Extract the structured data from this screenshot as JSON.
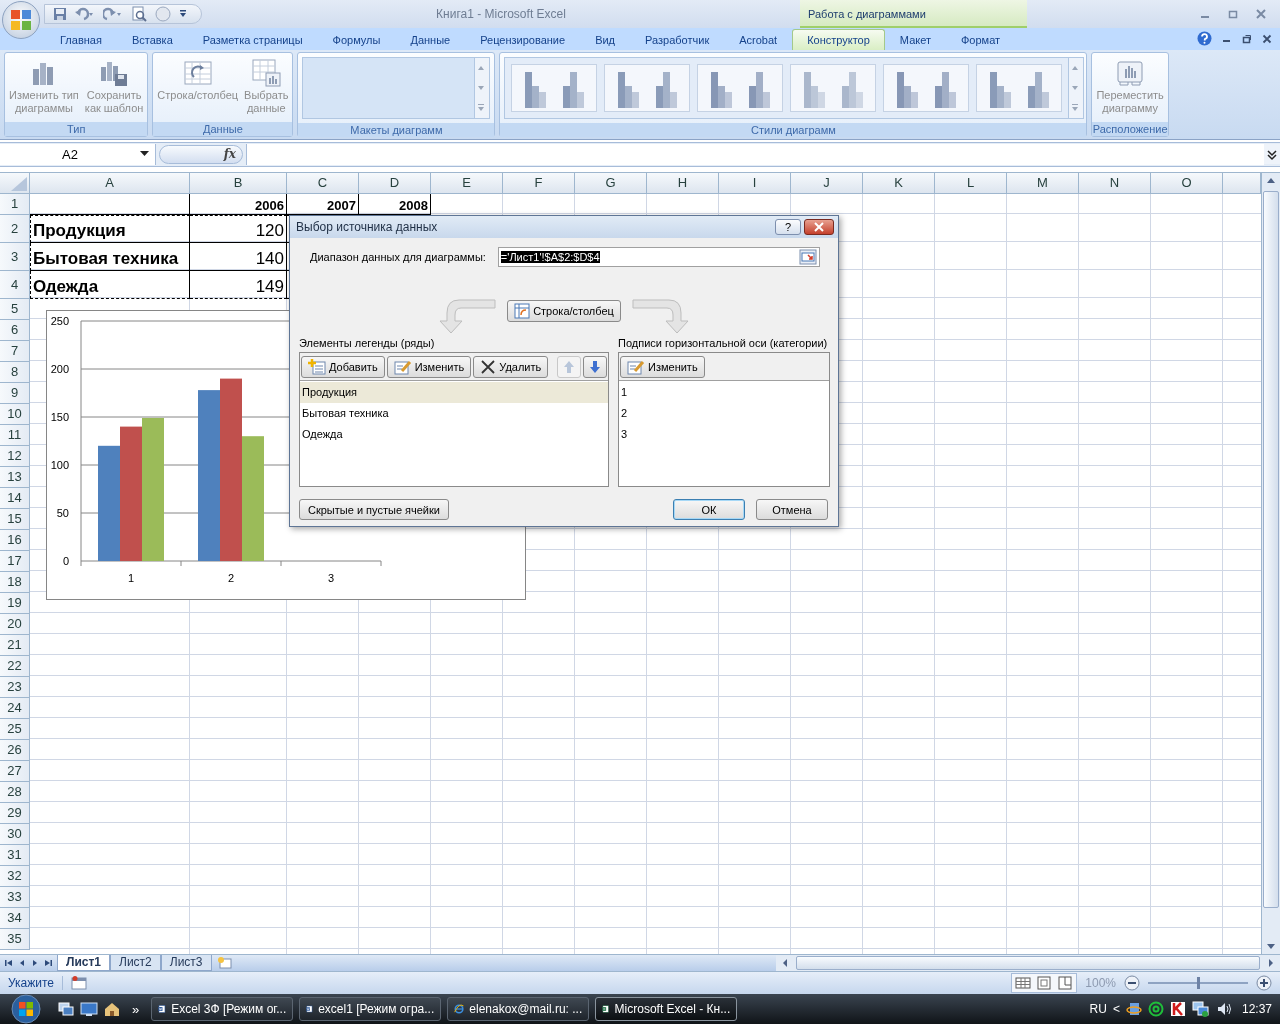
{
  "window": {
    "title": "Книга1  -  Microsoft Excel",
    "context_tab": "Работа с диаграммами"
  },
  "ribbon_tabs": [
    {
      "label": "Главная",
      "selected": false
    },
    {
      "label": "Вставка",
      "selected": false
    },
    {
      "label": "Разметка страницы",
      "selected": false
    },
    {
      "label": "Формулы",
      "selected": false
    },
    {
      "label": "Данные",
      "selected": false
    },
    {
      "label": "Рецензирование",
      "selected": false
    },
    {
      "label": "Вид",
      "selected": false
    },
    {
      "label": "Разработчик",
      "selected": false
    },
    {
      "label": "Acrobat",
      "selected": false
    },
    {
      "label": "Конструктор",
      "selected": true
    },
    {
      "label": "Макет",
      "selected": false
    },
    {
      "label": "Формат",
      "selected": false
    }
  ],
  "ribbon_groups": [
    {
      "kind": "buttons",
      "title": "Тип",
      "buttons": [
        {
          "kind": "chart",
          "lines": [
            "Изменить тип",
            "диаграммы"
          ],
          "disabled": true
        },
        {
          "kind": "template",
          "lines": [
            "Сохранить",
            "как шаблон"
          ],
          "disabled": true
        }
      ]
    },
    {
      "kind": "buttons",
      "title": "Данные",
      "buttons": [
        {
          "kind": "switch",
          "lines": [
            "Строка/столбец"
          ],
          "disabled": true
        },
        {
          "kind": "select",
          "lines": [
            "Выбрать",
            "данные"
          ],
          "disabled": true
        }
      ]
    },
    {
      "kind": "gallery",
      "title": "Макеты диаграмм"
    },
    {
      "kind": "styles",
      "title": "Стили диаграмм",
      "thumbnails": [
        {
          "color": "#8a9bb8"
        },
        {
          "color": "#8a9bb8"
        },
        {
          "color": "#8797b5"
        },
        {
          "color": "#aab7cc"
        },
        {
          "color": "#8797b5"
        },
        {
          "color": "#8a9bb8"
        }
      ]
    },
    {
      "kind": "buttons",
      "title": "Расположение",
      "buttons": [
        {
          "kind": "move",
          "lines": [
            "Переместить",
            "диаграмму"
          ],
          "disabled": true
        }
      ]
    }
  ],
  "formula_bar": {
    "name_box": "A2",
    "function_label": "fx"
  },
  "sheet": {
    "columns": [
      {
        "label": "A",
        "marked": true
      },
      {
        "label": "B",
        "marked": true
      },
      {
        "label": "C",
        "marked": true
      },
      {
        "label": "D",
        "marked": true
      },
      {
        "label": "E",
        "marked": false
      },
      {
        "label": "F",
        "marked": false
      },
      {
        "label": "G",
        "marked": false
      },
      {
        "label": "H",
        "marked": false
      },
      {
        "label": "I",
        "marked": false
      },
      {
        "label": "J",
        "marked": false
      },
      {
        "label": "K",
        "marked": false
      },
      {
        "label": "L",
        "marked": false
      },
      {
        "label": "M",
        "marked": false
      },
      {
        "label": "N",
        "marked": false
      },
      {
        "label": "O",
        "marked": false
      }
    ],
    "rows": [
      {
        "number": "1",
        "kind": "header",
        "marked": false,
        "cells": {
          "B": "2006",
          "C": "2007",
          "D": "2008"
        }
      },
      {
        "number": "2",
        "kind": "big",
        "marked": true,
        "cells": {
          "A": "Продукция",
          "B": "120"
        }
      },
      {
        "number": "3",
        "kind": "big",
        "marked": true,
        "cells": {
          "A": "Бытовая техника",
          "B": "140"
        }
      },
      {
        "number": "4",
        "kind": "big",
        "marked": true,
        "cells": {
          "A": "Одежда",
          "B": "149"
        }
      },
      {
        "number": "5",
        "kind": "plain",
        "marked": false
      },
      {
        "number": "6",
        "kind": "plain",
        "marked": false
      },
      {
        "number": "7",
        "kind": "plain",
        "marked": false
      },
      {
        "number": "8",
        "kind": "plain",
        "marked": false
      },
      {
        "number": "9",
        "kind": "plain",
        "marked": false
      },
      {
        "number": "10",
        "kind": "plain",
        "marked": false
      },
      {
        "number": "11",
        "kind": "plain",
        "marked": false
      },
      {
        "number": "12",
        "kind": "plain",
        "marked": false
      },
      {
        "number": "13",
        "kind": "plain",
        "marked": false
      },
      {
        "number": "14",
        "kind": "plain",
        "marked": false
      },
      {
        "number": "15",
        "kind": "plain",
        "marked": false
      },
      {
        "number": "16",
        "kind": "plain",
        "marked": false
      },
      {
        "number": "17",
        "kind": "plain",
        "marked": false
      },
      {
        "number": "18",
        "kind": "plain",
        "marked": false
      },
      {
        "number": "19",
        "kind": "plain",
        "marked": false
      },
      {
        "number": "20",
        "kind": "plain",
        "marked": false
      },
      {
        "number": "21",
        "kind": "plain",
        "marked": false
      },
      {
        "number": "22",
        "kind": "plain",
        "marked": false
      },
      {
        "number": "23",
        "kind": "plain",
        "marked": false
      },
      {
        "number": "24",
        "kind": "plain",
        "marked": false
      },
      {
        "number": "25",
        "kind": "plain",
        "marked": false
      },
      {
        "number": "26",
        "kind": "plain",
        "marked": false
      },
      {
        "number": "27",
        "kind": "plain",
        "marked": false
      },
      {
        "number": "28",
        "kind": "plain",
        "marked": false
      },
      {
        "number": "29",
        "kind": "plain",
        "marked": false
      },
      {
        "number": "30",
        "kind": "plain",
        "marked": false
      },
      {
        "number": "31",
        "kind": "plain",
        "marked": false
      },
      {
        "number": "32",
        "kind": "plain",
        "marked": false
      },
      {
        "number": "33",
        "kind": "plain",
        "marked": false
      },
      {
        "number": "34",
        "kind": "plain",
        "marked": false
      },
      {
        "number": "35",
        "kind": "plain",
        "marked": false
      }
    ]
  },
  "chart": {
    "chart_data": {
      "type": "bar",
      "grid": true,
      "categories": [
        "1",
        "2",
        "3"
      ],
      "ylim": [
        0,
        250
      ],
      "yticks": [
        0,
        50,
        100,
        150,
        200,
        250
      ],
      "series": [
        {
          "color": "#4f81bd",
          "values": [
            120,
            178,
            null
          ]
        },
        {
          "color": "#c0504d",
          "values": [
            140,
            190,
            null
          ]
        },
        {
          "color": "#9bbb59",
          "values": [
            149,
            130,
            null
          ]
        }
      ]
    }
  },
  "dialog": {
    "title": "Выбор источника данных",
    "help": "?",
    "range_label": "Диапазон данных для диаграммы:",
    "range_value": "='Лист1'!$A$2:$D$4",
    "switch_button": "Строка/столбец",
    "legend_title": "Элементы легенды (ряды)",
    "legend_buttons": [
      {
        "kind": "add",
        "label": "Добавить"
      },
      {
        "kind": "edit",
        "label": "Изменить"
      },
      {
        "kind": "delete",
        "label": "Удалить"
      }
    ],
    "order_buttons": [
      {
        "kind": "up",
        "disabled": true
      },
      {
        "kind": "down",
        "disabled": false
      }
    ],
    "series": [
      {
        "label": "Продукция",
        "selected": true
      },
      {
        "label": "Бытовая техника",
        "selected": false
      },
      {
        "label": "Одежда",
        "selected": false
      }
    ],
    "axis_title": "Подписи горизонтальной оси (категории)",
    "axis_button": "Изменить",
    "categories": [
      "1",
      "2",
      "3"
    ],
    "hidden_cells_button": "Скрытые и пустые ячейки",
    "ok_button": "ОК",
    "cancel_button": "Отмена"
  },
  "sheet_tabs": [
    {
      "label": "Лист1",
      "selected": true
    },
    {
      "label": "Лист2",
      "selected": false
    },
    {
      "label": "Лист3",
      "selected": false
    }
  ],
  "status_bar": {
    "mode": "Укажите",
    "zoom": "100%",
    "zoom_level": {
      "level": 0.5
    }
  },
  "taskbar": {
    "items": [
      {
        "kind": "word",
        "label": "Excel 3Ф [Режим ог...",
        "selected": false
      },
      {
        "kind": "word",
        "label": "excel1 [Режим огра...",
        "selected": false
      },
      {
        "kind": "ie",
        "label": "elenakox@mail.ru: ...",
        "selected": false
      },
      {
        "kind": "excel",
        "label": "Microsoft Excel - Кн...",
        "selected": true
      }
    ],
    "more": "»",
    "language": "RU",
    "tray_toggle": "<",
    "time": "12:37"
  }
}
